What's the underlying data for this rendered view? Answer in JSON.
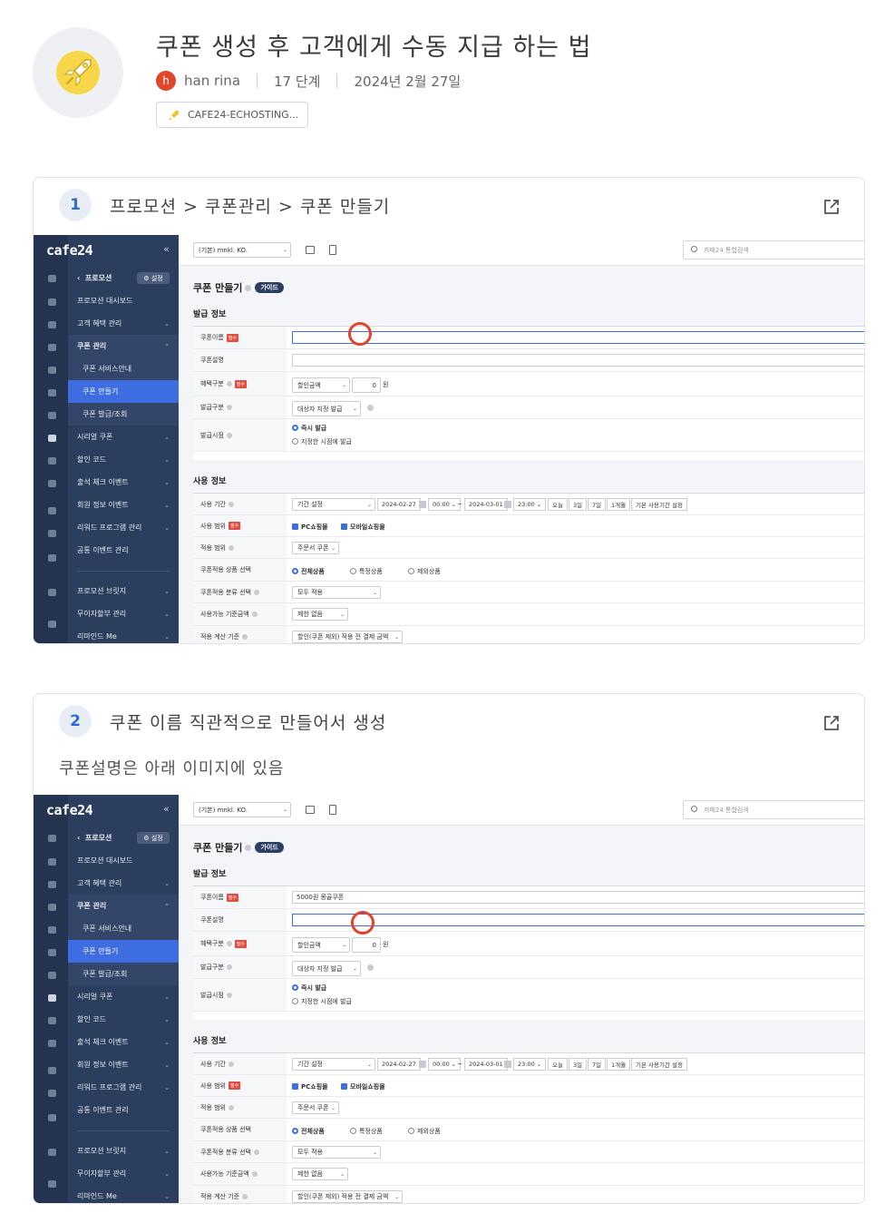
{
  "header": {
    "title": "쿠폰 생성 후 고객에게 수동 지급 하는 법",
    "avatar_initial": "h",
    "author": "han rina",
    "steps": "17 단계",
    "date": "2024년 2월 27일",
    "tag": "CAFE24-ECHOSTING...",
    "icon": "rocket-icon"
  },
  "steps": [
    {
      "number": "1",
      "caption": "프로모션 > 쿠폰관리 > 쿠폰 만들기",
      "description": ""
    },
    {
      "number": "2",
      "caption": "쿠폰 이름 직관적으로 만들어서 생성",
      "description": "쿠폰설명은 아래 이미지에 있음"
    }
  ],
  "shot": {
    "brand": "cafe24",
    "collapse": "«",
    "nav_back": "프로모션",
    "settings": "설정",
    "shop_select": "(기본) mnkl. KO.",
    "search_placeholder": "카페24 통합검색",
    "menu": {
      "dashboard": "프로모션 대시보드",
      "benefits": "고객 혜택 관리",
      "coupon_mgmt": "쿠폰 관리",
      "coupon_guide": "쿠폰 서비스안내",
      "coupon_create": "쿠폰 만들기",
      "coupon_issue": "쿠폰 발급/조회",
      "serial": "시리얼 쿠폰",
      "discount_code": "할인 코드",
      "attendance": "출석 체크 이벤트",
      "member_event": "회원 정보 이벤트",
      "review": "리워드 프로그램 관리",
      "common_event": "공통 이벤트 관리",
      "promo_badge": "프로모션 브릿지",
      "installment": "무이자할부 관리",
      "remind": "리마인드 Me"
    },
    "page_title": "쿠폰 만들기",
    "guide": "가이드",
    "issue_section": "발급 정보",
    "usage_section": "사용 정보",
    "required": "필수",
    "labels": {
      "coupon_name": "쿠폰이름",
      "coupon_desc": "쿠폰설명",
      "benefit": "혜택구분",
      "issue_type": "발급구분",
      "issue_time": "발급시점",
      "period": "사용 기간",
      "scope": "사용 범위",
      "apply_scope": "적용 범위",
      "product_select": "쿠폰적용 상품 선택",
      "category_select": "쿠폰적용 분류 선택",
      "min_amount": "사용가능 기준금액",
      "calc_basis": "적용 계산 기준"
    },
    "values": {
      "benefit_type": "할인금액",
      "benefit_amount": "0",
      "won": "원",
      "issue_type": "대상자 지정 발급",
      "immediate": "즉시 발급",
      "scheduled": "지정한 시점에 발급",
      "period_type": "기간 설정",
      "start_date": "2024-02-27",
      "start_time": "00:00",
      "end_date": "2024-03-01",
      "end_time": "23:00",
      "today": "오늘",
      "d3": "3일",
      "d7": "7일",
      "m1": "1개월",
      "default_period": "기본 사용기간 설정",
      "pc": "PC쇼핑몰",
      "mobile": "모바일쇼핑몰",
      "apply_scope": "주문서 쿠폰",
      "all_products": "전체상품",
      "specific": "특정상품",
      "excluded": "제외상품",
      "category": "모두 적용",
      "min_amount": "제한 없음",
      "calc_basis": "할인(쿠폰 제외) 적용 전 결제 금액"
    },
    "step2_coupon_name": "5000원 몽골쿠폰"
  },
  "colors": {
    "accent": "#3d6de0",
    "nav": "#2c3e5e",
    "marker": "#e0432b"
  }
}
